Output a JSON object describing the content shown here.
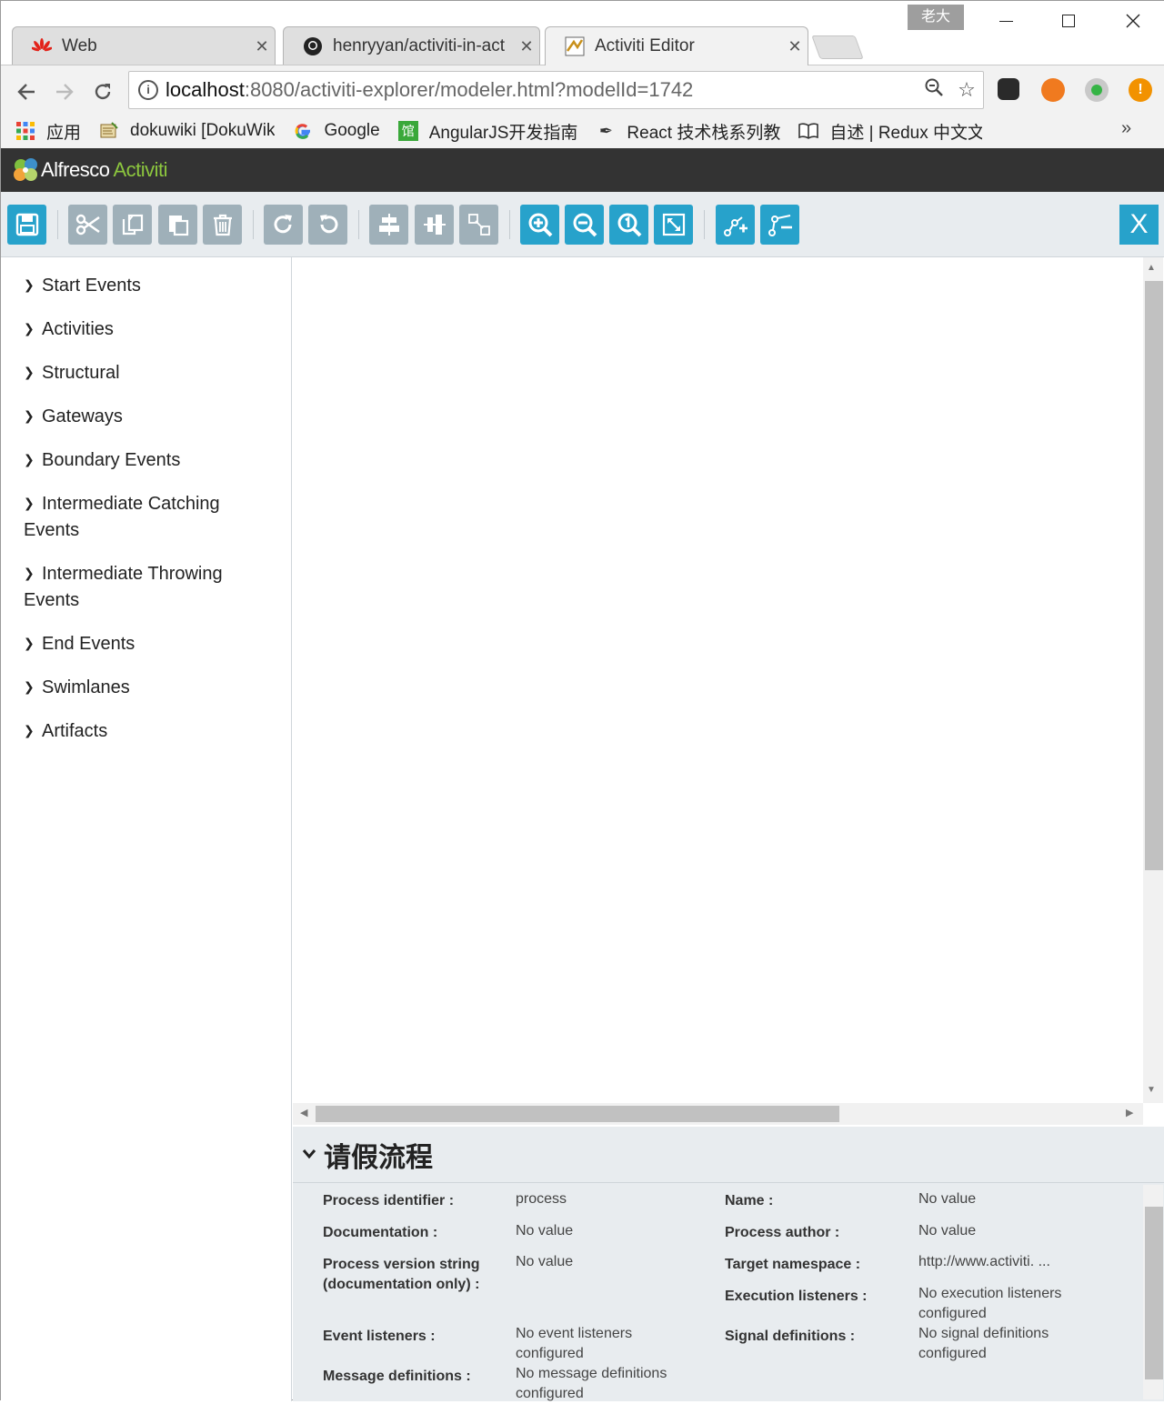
{
  "browser": {
    "profile_name": "老大",
    "tabs": [
      {
        "label": "Web",
        "icon": "huawei-icon",
        "active": false
      },
      {
        "label": "henryyan/activiti-in-act",
        "icon": "github-icon",
        "active": false
      },
      {
        "label": "Activiti Editor",
        "icon": "activiti-icon",
        "active": true
      }
    ],
    "url_host": "localhost",
    "url_rest": ":8080/activiti-explorer/modeler.html?modelId=1742",
    "bookmarks": [
      {
        "label": "应用",
        "icon": "apps-icon"
      },
      {
        "label": "dokuwiki [DokuWik",
        "icon": "dokuwiki-icon"
      },
      {
        "label": "Google",
        "icon": "google-icon"
      },
      {
        "label": "AngularJS开发指南",
        "icon": "angular-icon"
      },
      {
        "label": "React 技术栈系列教",
        "icon": "react-icon"
      },
      {
        "label": "自述 | Redux 中文文",
        "icon": "book-icon"
      }
    ],
    "bookmarks_more": "»"
  },
  "app": {
    "logo_part1": "Alfresco",
    "logo_part2": "Activiti",
    "close_label": "X",
    "palette": [
      "Start Events",
      "Activities",
      "Structural",
      "Gateways",
      "Boundary Events",
      "Intermediate Catching Events",
      "Intermediate Throwing Events",
      "End Events",
      "Swimlanes",
      "Artifacts"
    ],
    "properties": {
      "title": "请假流程",
      "left": [
        {
          "label": "Process identifier :",
          "value": "process"
        },
        {
          "label": "Documentation :",
          "value": "No value"
        },
        {
          "label": "Process version string (documentation only) :",
          "value": "No value"
        },
        {
          "label": "Event listeners :",
          "value": "No event listeners configured"
        },
        {
          "label": "Message definitions :",
          "value": "No message definitions configured"
        }
      ],
      "right": [
        {
          "label": "Name :",
          "value": "No value"
        },
        {
          "label": "Process author :",
          "value": "No value"
        },
        {
          "label": "Target namespace :",
          "value": "http://www.activiti. ..."
        },
        {
          "label": "Execution listeners :",
          "value": "No execution listeners configured"
        },
        {
          "label": "Signal definitions :",
          "value": "No signal definitions configured"
        }
      ]
    }
  },
  "colors": {
    "toolbar_blue": "#27a2cb",
    "toolbar_grey": "#9fb0b9",
    "header_dark": "#333333",
    "activiti_green": "#8cc63e"
  }
}
